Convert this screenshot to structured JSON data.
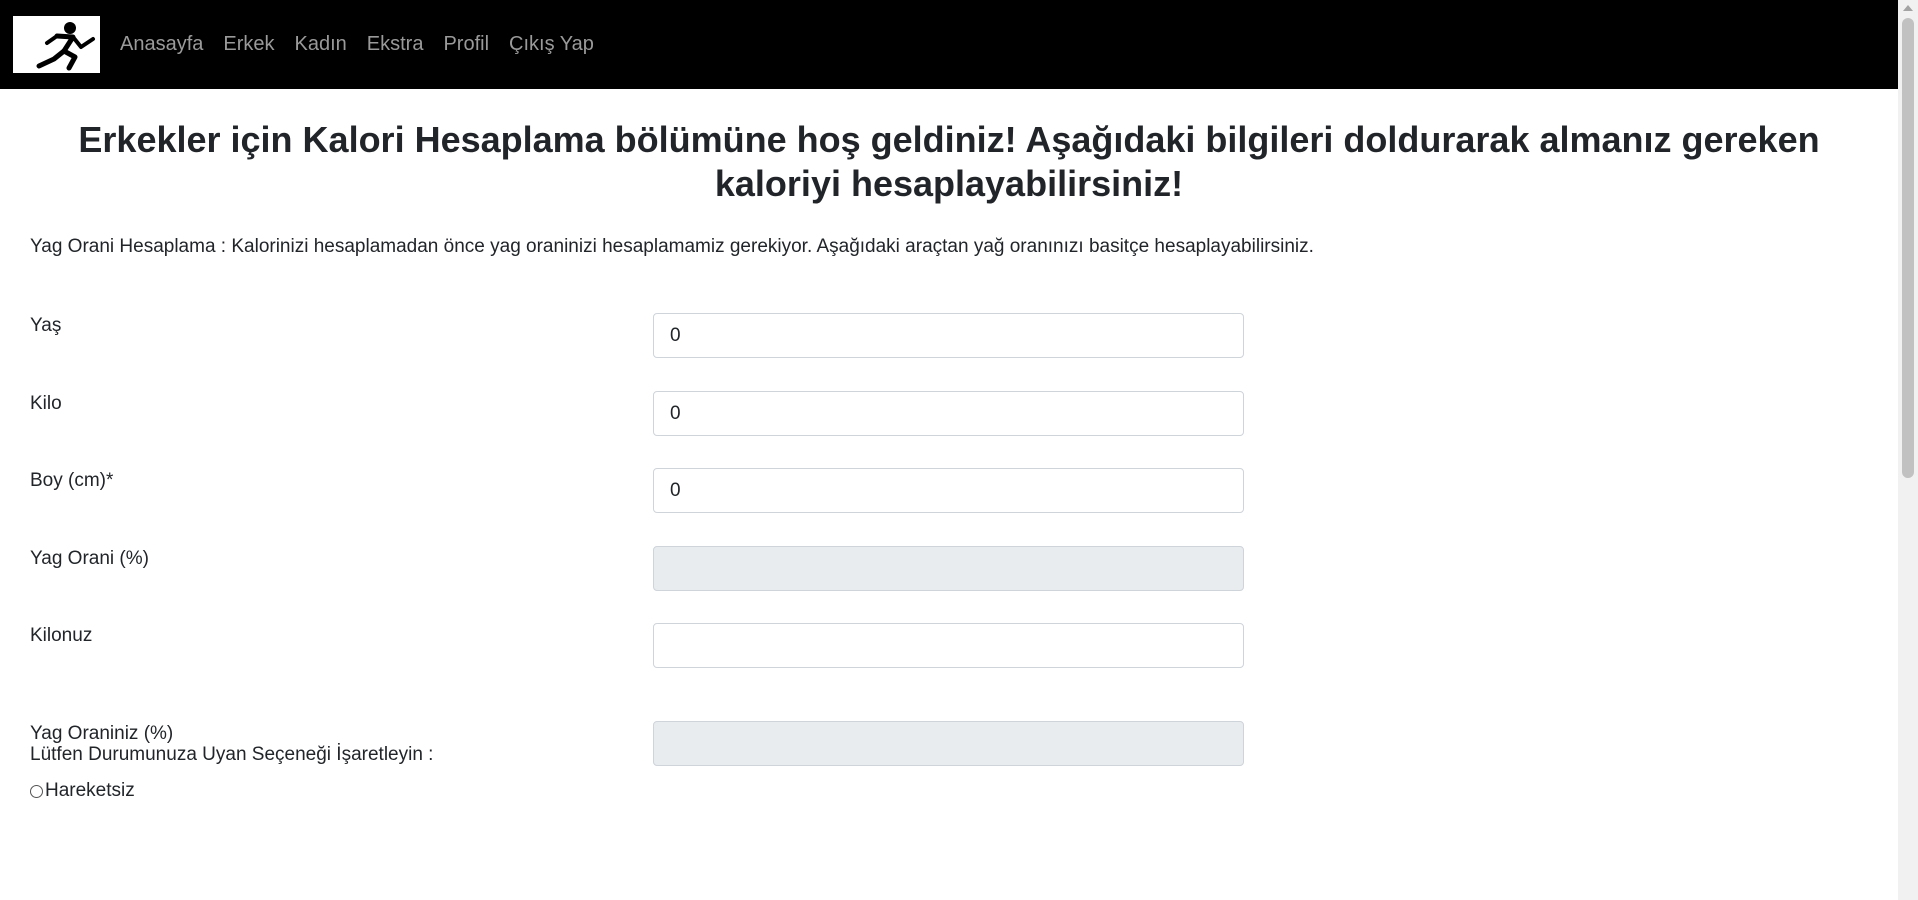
{
  "nav": {
    "logo_icon": "running-man-icon",
    "links": [
      "Anasayfa",
      "Erkek",
      "Kadın",
      "Ekstra",
      "Profil",
      "Çıkış Yap"
    ]
  },
  "main": {
    "title": "Erkekler için Kalori Hesaplama bölümüne hoş geldiniz! Aşağıdaki bilgileri doldurarak almanız gereken kaloriyi hesaplayabilirsiniz!",
    "intro": "Yag Orani Hesaplama : Kalorinizi hesaplamadan önce yag oraninizi hesaplamamiz gerekiyor. Aşağıdaki araçtan yağ oranınızı basitçe hesaplayabilirsiniz.",
    "fields": [
      {
        "label": "Yaş",
        "value": "0"
      },
      {
        "label": "Kilo",
        "value": "0"
      },
      {
        "label": "Boy (cm)*",
        "value": "0"
      },
      {
        "label": "Yag Orani (%)",
        "value": ""
      },
      {
        "label": "Kilonuz",
        "value": ""
      },
      {
        "label": "Yag Oraniniz (%)",
        "value": ""
      }
    ],
    "activity_prompt": "Lütfen Durumunuza Uyan Seçeneği İşaretleyin :",
    "options": [
      "Hareketsiz"
    ]
  },
  "colors": {
    "navbar_bg": "#000000",
    "nav_link": "#9a9a9a",
    "readonly_bg": "#e9ecef"
  }
}
